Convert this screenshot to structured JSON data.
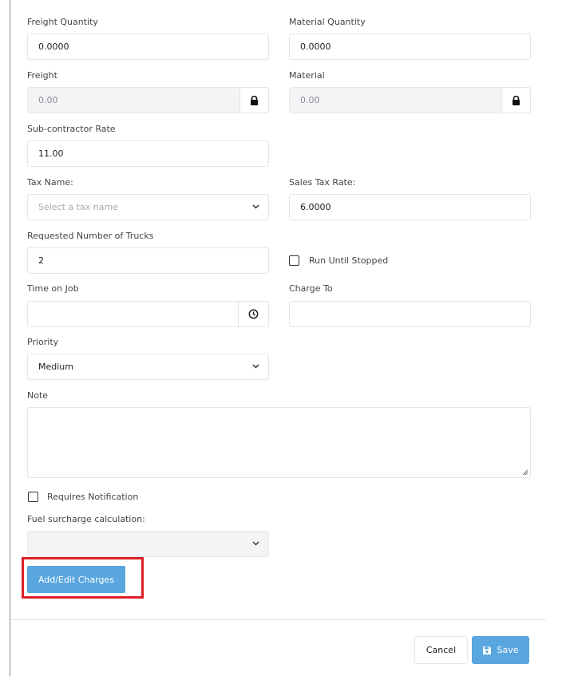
{
  "form": {
    "freight_quantity": {
      "label": "Freight Quantity",
      "value": "0.0000"
    },
    "material_quantity": {
      "label": "Material Quantity",
      "value": "0.0000"
    },
    "freight": {
      "label": "Freight",
      "value": "0.00",
      "locked": true
    },
    "material": {
      "label": "Material",
      "value": "0.00",
      "locked": true
    },
    "subcontractor_rate": {
      "label": "Sub-contractor Rate",
      "value": "11.00"
    },
    "tax_name": {
      "label": "Tax Name:",
      "placeholder": "Select a tax name"
    },
    "sales_tax_rate": {
      "label": "Sales Tax Rate:",
      "value": "6.0000"
    },
    "requested_trucks": {
      "label": "Requested Number of Trucks",
      "value": "2"
    },
    "run_until_stopped": {
      "label": "Run Until Stopped",
      "checked": false
    },
    "time_on_job": {
      "label": "Time on Job",
      "value": ""
    },
    "charge_to": {
      "label": "Charge To",
      "value": ""
    },
    "priority": {
      "label": "Priority",
      "value": "Medium"
    },
    "note": {
      "label": "Note",
      "value": ""
    },
    "requires_notification": {
      "label": "Requires Notification",
      "checked": false
    },
    "fuel_surcharge": {
      "label": "Fuel surcharge calculation:",
      "value": ""
    },
    "add_edit_charges_label": "Add/Edit Charges"
  },
  "footer": {
    "cancel_label": "Cancel",
    "save_label": "Save"
  },
  "colors": {
    "primary": "#5aa6df",
    "highlight": "#dd1f26",
    "disabled_bg": "#f3f4f6",
    "border": "#e3e6ea"
  },
  "icons": [
    "lock-icon",
    "clock-icon",
    "chevron-down-icon",
    "save-icon"
  ]
}
